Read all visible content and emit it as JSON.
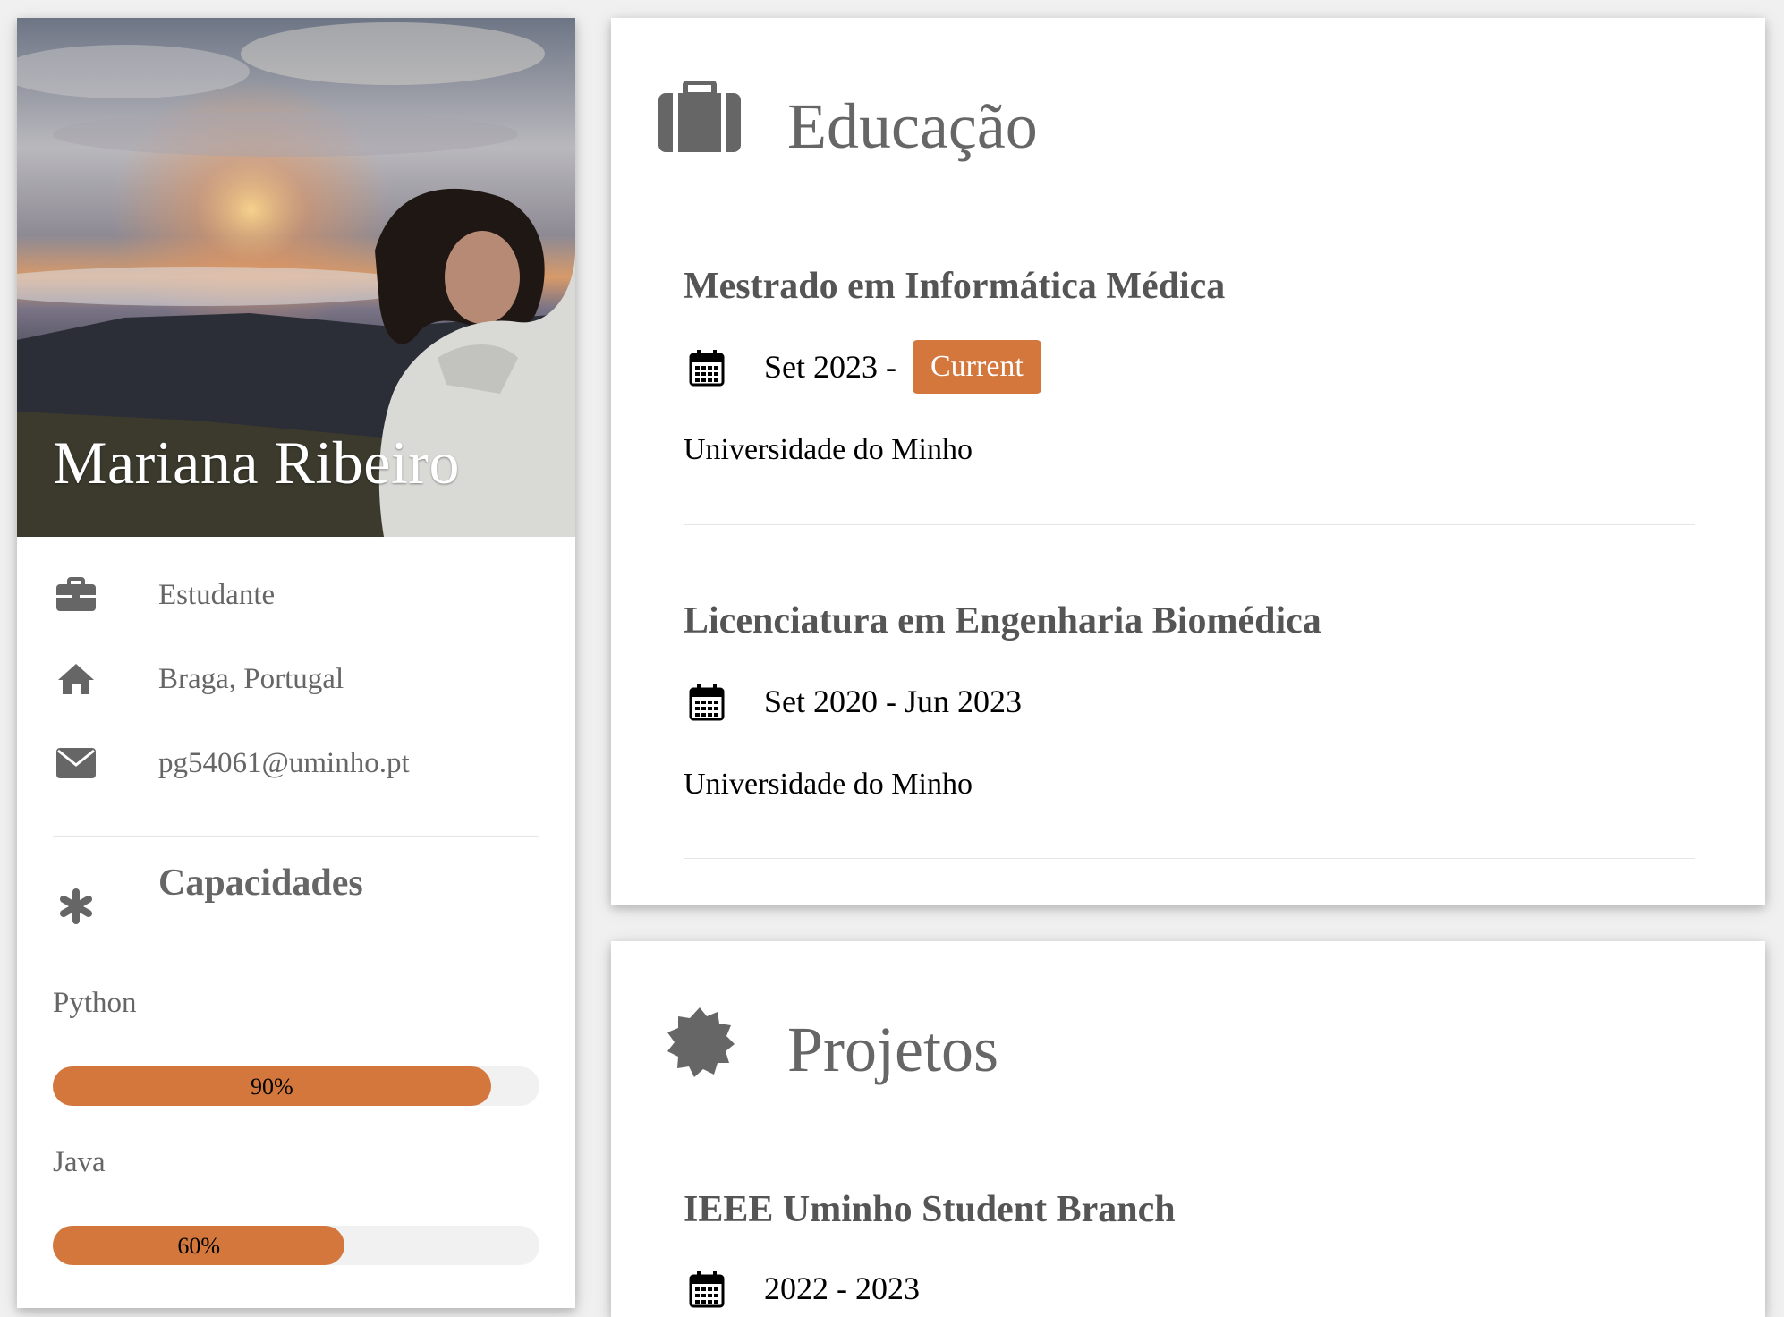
{
  "profile": {
    "name": "Mariana Ribeiro",
    "info": {
      "occupation": "Estudante",
      "location": "Braga, Portugal",
      "email": "pg54061@uminho.pt"
    },
    "skills_heading": "Capacidades",
    "skills": [
      {
        "label": "Python",
        "percent_label": "90%",
        "value": 90
      },
      {
        "label": "Java",
        "percent_label": "60%",
        "value": 60
      }
    ]
  },
  "education": {
    "title": "Educação",
    "entries": [
      {
        "title": "Mestrado em Informática Médica",
        "date": "Set 2023 -",
        "badge": "Current",
        "institution": "Universidade do Minho"
      },
      {
        "title": "Licenciatura em Engenharia Biomédica",
        "date": "Set 2020 - Jun 2023",
        "institution": "Universidade do Minho"
      }
    ]
  },
  "projects": {
    "title": "Projetos",
    "entries": [
      {
        "title": "IEEE Uminho Student Branch",
        "date": "2022 - 2023"
      }
    ]
  },
  "colors": {
    "accent": "#d3773d",
    "text": "#555555",
    "background": "#f0f0f0"
  },
  "icons": {
    "occupation": "briefcase-icon",
    "location": "home-icon",
    "email": "envelope-icon",
    "skills": "asterisk-icon",
    "education": "suitcase-icon",
    "projects": "certificate-icon",
    "date": "calendar-icon"
  }
}
